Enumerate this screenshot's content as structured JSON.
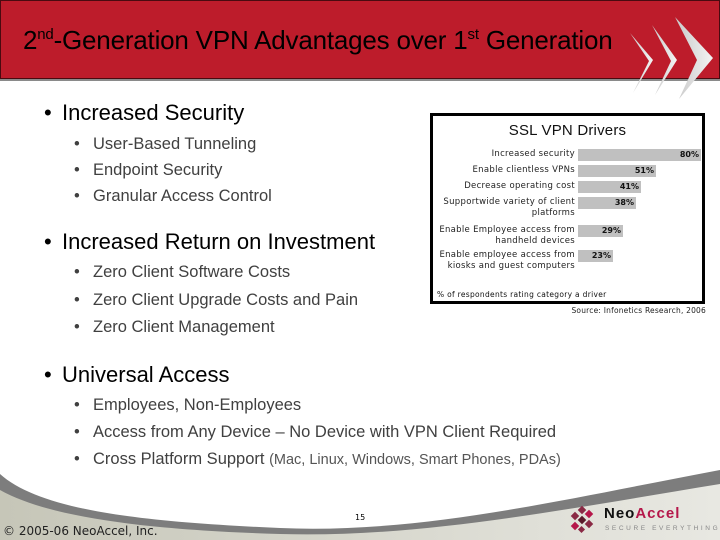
{
  "slide": {
    "title": {
      "prefix_num": "2",
      "prefix_sup": "nd",
      "middle": "-Generation VPN Advantages over 1",
      "middle_sup": "st",
      "suffix": " Generation"
    },
    "colors": {
      "header_red": "#bd1c2b",
      "bar_gray": "#c0c0c0",
      "accent_magenta": "#b5174a"
    }
  },
  "bullets": [
    {
      "label": "Increased Security",
      "children": [
        "User-Based Tunneling",
        "Endpoint Security",
        "Granular Access Control"
      ]
    },
    {
      "label": "Increased Return on Investment",
      "children": [
        "Zero Client Software Costs",
        "Zero Client Upgrade Costs and Pain",
        "Zero Client Management"
      ]
    },
    {
      "label": "Universal Access",
      "children": [
        "Employees, Non-Employees",
        "Access from Any Device – No Device with VPN Client Required",
        "Cross Platform Support"
      ],
      "last_child_aside": "(Mac, Linux, Windows, Smart Phones, PDAs)"
    }
  ],
  "chart_data": {
    "type": "bar",
    "orientation": "horizontal",
    "title": "SSL VPN Drivers",
    "categories": [
      "Increased security",
      "Enable clientless VPNs",
      "Decrease operating cost",
      "Support wide variety of client platforms",
      "Enable Employee access from handheld devices",
      "Enable employee access from kiosks and guest computers"
    ],
    "category_lines": [
      [
        "Increased security"
      ],
      [
        "Enable clientless VPNs"
      ],
      [
        "Decrease operating cost"
      ],
      [
        "Supportwide variety of client",
        "platforms"
      ],
      [
        "Enable Employee access from",
        "handheld devices"
      ],
      [
        "Enable employee access from",
        "kiosks and guest computers"
      ]
    ],
    "values": [
      80,
      51,
      41,
      38,
      29,
      23
    ],
    "value_labels": [
      "80%",
      "51%",
      "41%",
      "38%",
      "29%",
      "23%"
    ],
    "unit": "%",
    "xlim": [
      0,
      80
    ],
    "grid": false,
    "legend": "none",
    "footnote": "% of respondents rating category a driver",
    "source": "Source: Infonetics Research, 2006"
  },
  "footer": {
    "copyright": "© 2005-06 NeoAccel, Inc.",
    "page_number": "15",
    "logo_name_part1": "Neo",
    "logo_name_part2": "Accel",
    "logo_tagline": "SECURE EVERYTHING",
    "logo_icon": "diamond-grid-icon"
  }
}
